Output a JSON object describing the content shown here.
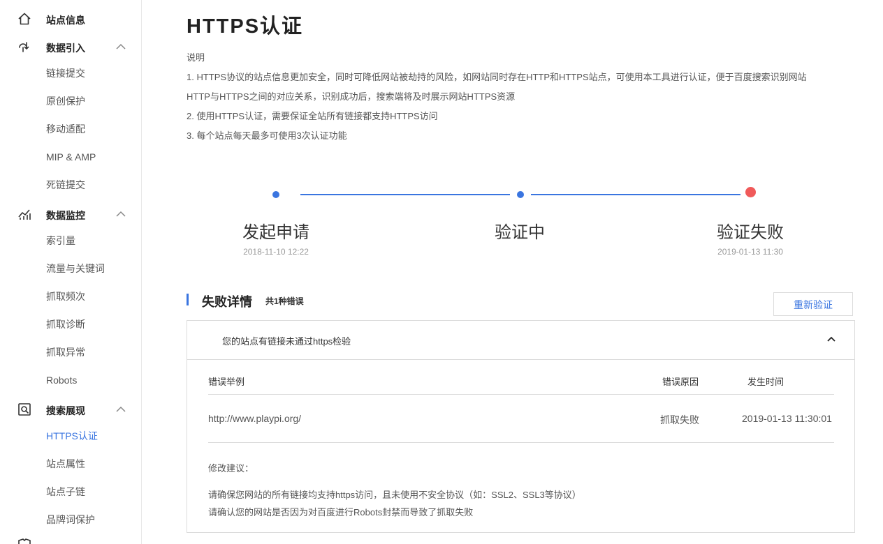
{
  "sidebar": {
    "groups": [
      {
        "label": "站点信息",
        "icon": "home-icon"
      },
      {
        "label": "数据引入",
        "icon": "data-import-icon"
      },
      {
        "label": "数据监控",
        "icon": "chart-icon"
      },
      {
        "label": "搜索展现",
        "icon": "search-display-icon"
      }
    ],
    "items": [
      {
        "label": "链接提交"
      },
      {
        "label": "原创保护"
      },
      {
        "label": "移动适配"
      },
      {
        "label": "MIP & AMP"
      },
      {
        "label": "死链提交"
      },
      {
        "label": "索引量"
      },
      {
        "label": "流量与关键词"
      },
      {
        "label": "抓取频次"
      },
      {
        "label": "抓取诊断"
      },
      {
        "label": "抓取异常"
      },
      {
        "label": "Robots"
      },
      {
        "label": "HTTPS认证"
      },
      {
        "label": "站点属性"
      },
      {
        "label": "站点子链"
      },
      {
        "label": "品牌词保护"
      }
    ],
    "active_color": "#3a75e0"
  },
  "page": {
    "title": "HTTPS认证",
    "description": {
      "heading": "说明",
      "lines": [
        "1. HTTPS协议的站点信息更加安全，同时可降低网站被劫持的风险，如网站同时存在HTTP和HTTPS站点，可使用本工具进行认证，便于百度搜索识别网站",
        "HTTP与HTTPS之间的对应关系，识别成功后，搜索端将及时展示网站HTTPS资源",
        "2. 使用HTTPS认证，需要保证全站所有链接都支持HTTPS访问",
        "3. 每个站点每天最多可使用3次认证功能"
      ]
    }
  },
  "progress": {
    "steps": [
      {
        "label": "发起申请",
        "time": "2018-11-10 12:22"
      },
      {
        "label": "验证中",
        "time": ""
      },
      {
        "label": "验证失败",
        "time": "2019-01-13 11:30"
      }
    ],
    "line_color": "#3a75e0",
    "fail_color": "#f05a5a"
  },
  "failure": {
    "title": "失败详情",
    "count": "共1种错误",
    "retry_label": "重新验证",
    "panel_title": "您的站点有链接未通过https检验",
    "columns": [
      "错误举例",
      "错误原因",
      "发生时间"
    ],
    "rows": [
      {
        "url": "http://www.playpi.org/",
        "reason": "抓取失败",
        "time": "2019-01-13 11:30:01"
      }
    ],
    "suggestion_heading": "修改建议：",
    "suggestions": [
      "请确保您网站的所有链接均支持https访问，且未使用不安全协议（如：SSL2、SSL3等协议）",
      "请确认您的网站是否因为对百度进行Robots封禁而导致了抓取失败"
    ]
  }
}
